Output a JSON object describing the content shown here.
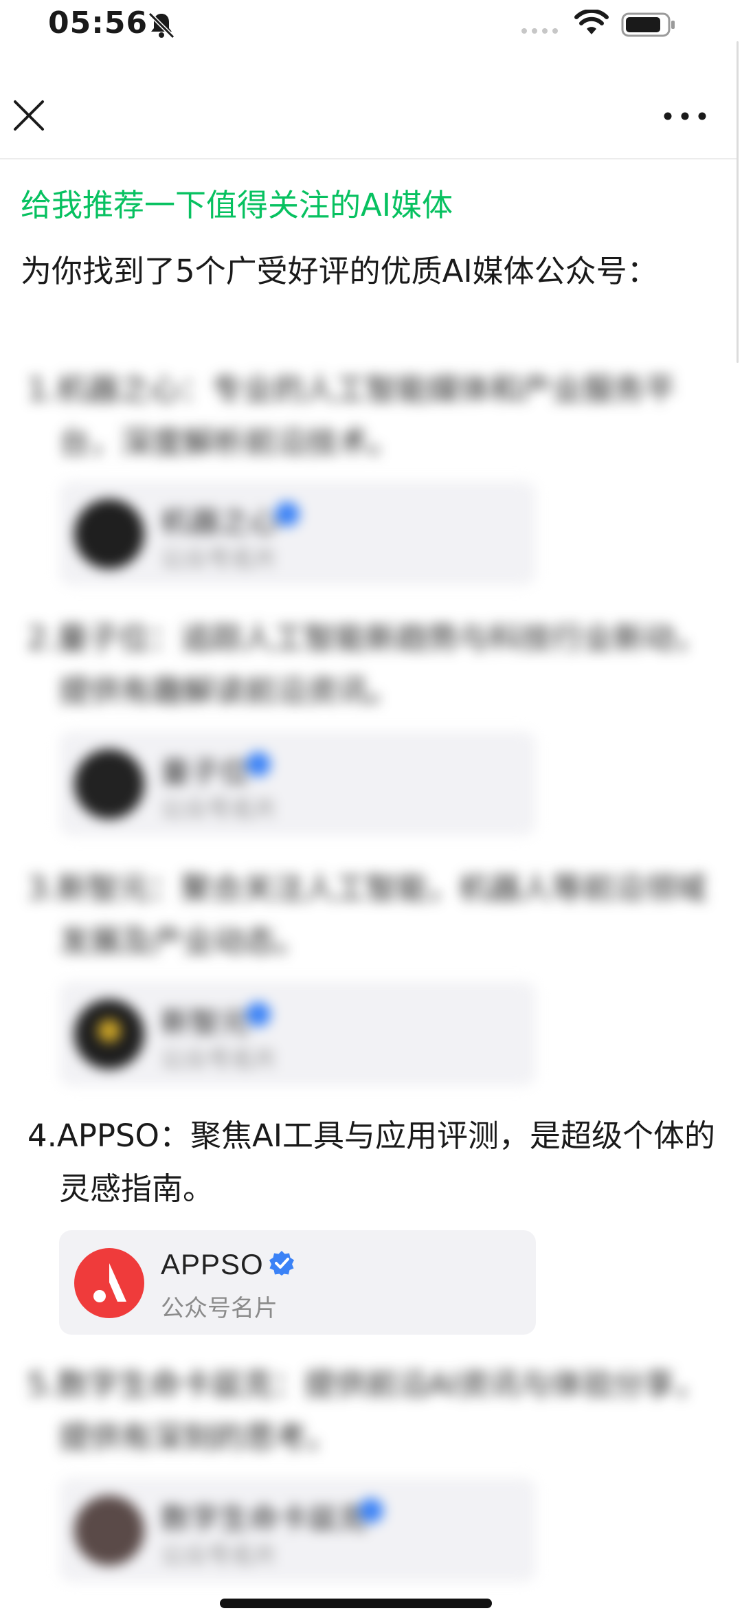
{
  "status_bar": {
    "time": "05:56",
    "icons": [
      "bell-slash-icon",
      "signal-icon",
      "wifi-icon",
      "battery-icon"
    ]
  },
  "nav": {
    "close_icon": "close-icon",
    "more_icon": "more-icon"
  },
  "conversation": {
    "question": "给我推荐一下值得关注的AI媒体",
    "answer_intro": "为你找到了5个广受好评的优质AI媒体公众号："
  },
  "items": [
    {
      "text": "1.机器之心：专业的人工智能媒体和产业服务平台，深度解析前沿技术。",
      "card_name": "机器之心",
      "card_sub": "公众号名片"
    },
    {
      "text": "2.量子位：追踪人工智能新趋势与科技行业新动，提供有趣解读前沿资讯。",
      "card_name": "量子位",
      "card_sub": "公众号名片"
    },
    {
      "text": "3.新智元：聚合关注人工智能，机器人等前沿领域发展及产业动态。",
      "card_name": "新智元",
      "card_sub": "公众号名片"
    },
    {
      "text": "4.APPSO：聚焦AI工具与应用评测，是超级个体的灵感指南。",
      "card_name": "APPSO",
      "card_sub": "公众号名片"
    },
    {
      "text": "5.数字生命卡兹克：提供前沿AI资讯与体验分享，提供有深刻的思考。",
      "card_name": "数字生命卡兹克",
      "card_sub": "公众号名片"
    }
  ],
  "colors": {
    "question": "#07c160",
    "verified": "#3b82f6",
    "appso_avatar": "#ef3b3b",
    "card_bg": "#f2f2f5"
  }
}
